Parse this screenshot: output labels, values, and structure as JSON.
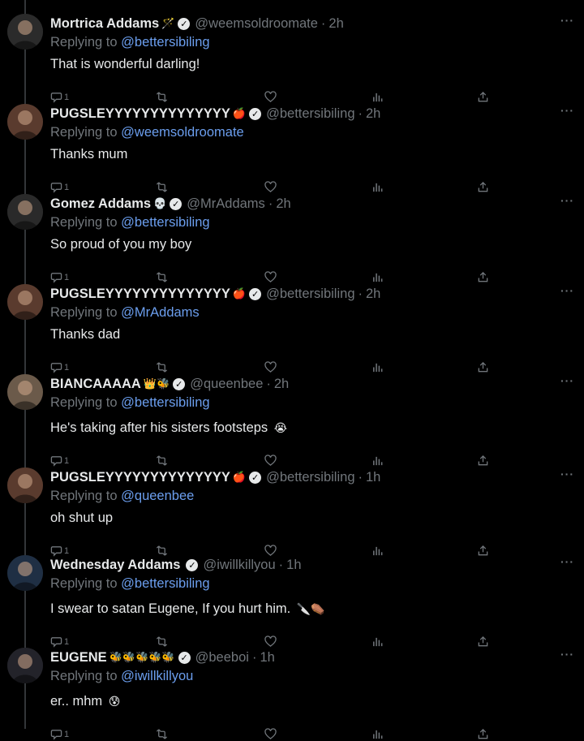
{
  "replying_to_label": "Replying to",
  "tweets": [
    {
      "name": "Mortrica Addams",
      "emoji": "🪄",
      "handle": "@weemsoldroomate",
      "time": "2h",
      "reply_to": "@bettersibiling",
      "text": "That is wonderful darling!",
      "text_emoji": "",
      "replies": "1",
      "avatar_color": "#2b2b2b"
    },
    {
      "name": "PUGSLEYYYYYYYYYYYYYY",
      "emoji": "🍎",
      "handle": "@bettersibiling",
      "time": "2h",
      "reply_to": "@weemsoldroomate",
      "text": "Thanks mum",
      "text_emoji": "",
      "replies": "1",
      "avatar_color": "#5a3b2e"
    },
    {
      "name": "Gomez Addams",
      "emoji": "💀",
      "handle": "@MrAddams",
      "time": "2h",
      "reply_to": "@bettersibiling",
      "text": "So proud of you my boy",
      "text_emoji": "",
      "replies": "1",
      "avatar_color": "#2a2a2a"
    },
    {
      "name": "PUGSLEYYYYYYYYYYYYYY",
      "emoji": "🍎",
      "handle": "@bettersibiling",
      "time": "2h",
      "reply_to": "@MrAddams",
      "text": "Thanks dad",
      "text_emoji": "",
      "replies": "1",
      "avatar_color": "#5a3b2e"
    },
    {
      "name": "BIANCAAAAA",
      "emoji": "👑🐝",
      "handle": "@queenbee",
      "time": "2h",
      "reply_to": "@bettersibiling",
      "text": "He's taking after his sisters footsteps",
      "text_emoji": "😭",
      "replies": "1",
      "avatar_color": "#6b5a4a"
    },
    {
      "name": "PUGSLEYYYYYYYYYYYYYY",
      "emoji": "🍎",
      "handle": "@bettersibiling",
      "time": "1h",
      "reply_to": "@queenbee",
      "text": "oh shut up",
      "text_emoji": "",
      "replies": "1",
      "avatar_color": "#5a3b2e"
    },
    {
      "name": "Wednesday Addams",
      "emoji": "",
      "handle": "@iwillkillyou",
      "time": "1h",
      "reply_to": "@bettersibiling",
      "text": "I swear to satan Eugene, If you hurt him.",
      "text_emoji": "🔪⚰️",
      "replies": "1",
      "avatar_color": "#1f2f44"
    },
    {
      "name": "EUGENE",
      "emoji": "🐝🐝🐝🐝🐝",
      "handle": "@beeboi",
      "time": "1h",
      "reply_to": "@iwillkillyou",
      "text": "er.. mhm",
      "text_emoji": "😰",
      "replies": "1",
      "avatar_color": "#23232a"
    }
  ]
}
